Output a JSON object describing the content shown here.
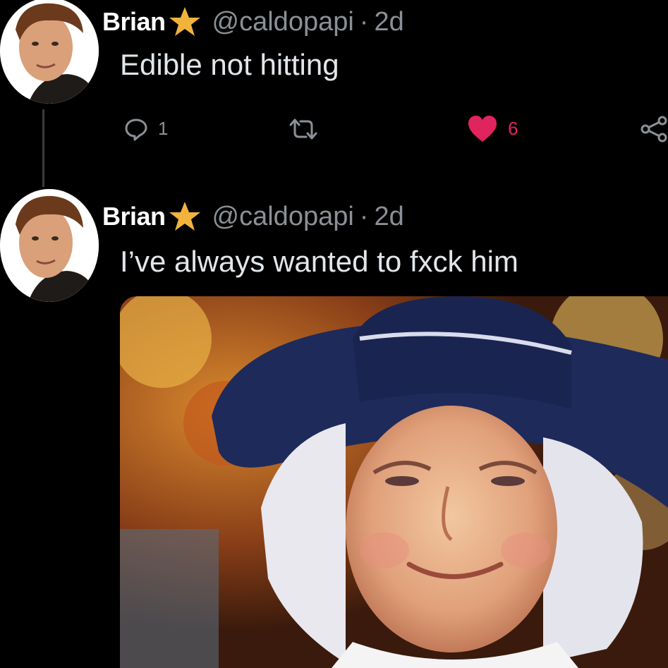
{
  "tweets": [
    {
      "author": {
        "name": "Brian",
        "handle": "@caldopapi",
        "badge": "star-icon"
      },
      "separator": "·",
      "time": "2d",
      "text": "Edible not hitting",
      "actions": {
        "reply_count": "1",
        "retweet_count": "",
        "like_count": "6",
        "liked": true
      }
    },
    {
      "author": {
        "name": "Brian",
        "handle": "@caldopapi",
        "badge": "star-icon"
      },
      "separator": "·",
      "time": "2d",
      "text": "I’ve always wanted to fxck him",
      "media": {
        "type": "image",
        "subject": "painted-portrait"
      }
    }
  ],
  "colors": {
    "background": "#000000",
    "name": "#ffffff",
    "secondary_text": "#8b9096",
    "body_text": "#e2e6ea",
    "like_red": "#e0245e",
    "star_gold": "#f2b33d",
    "thread_line": "#3b3b3b"
  }
}
